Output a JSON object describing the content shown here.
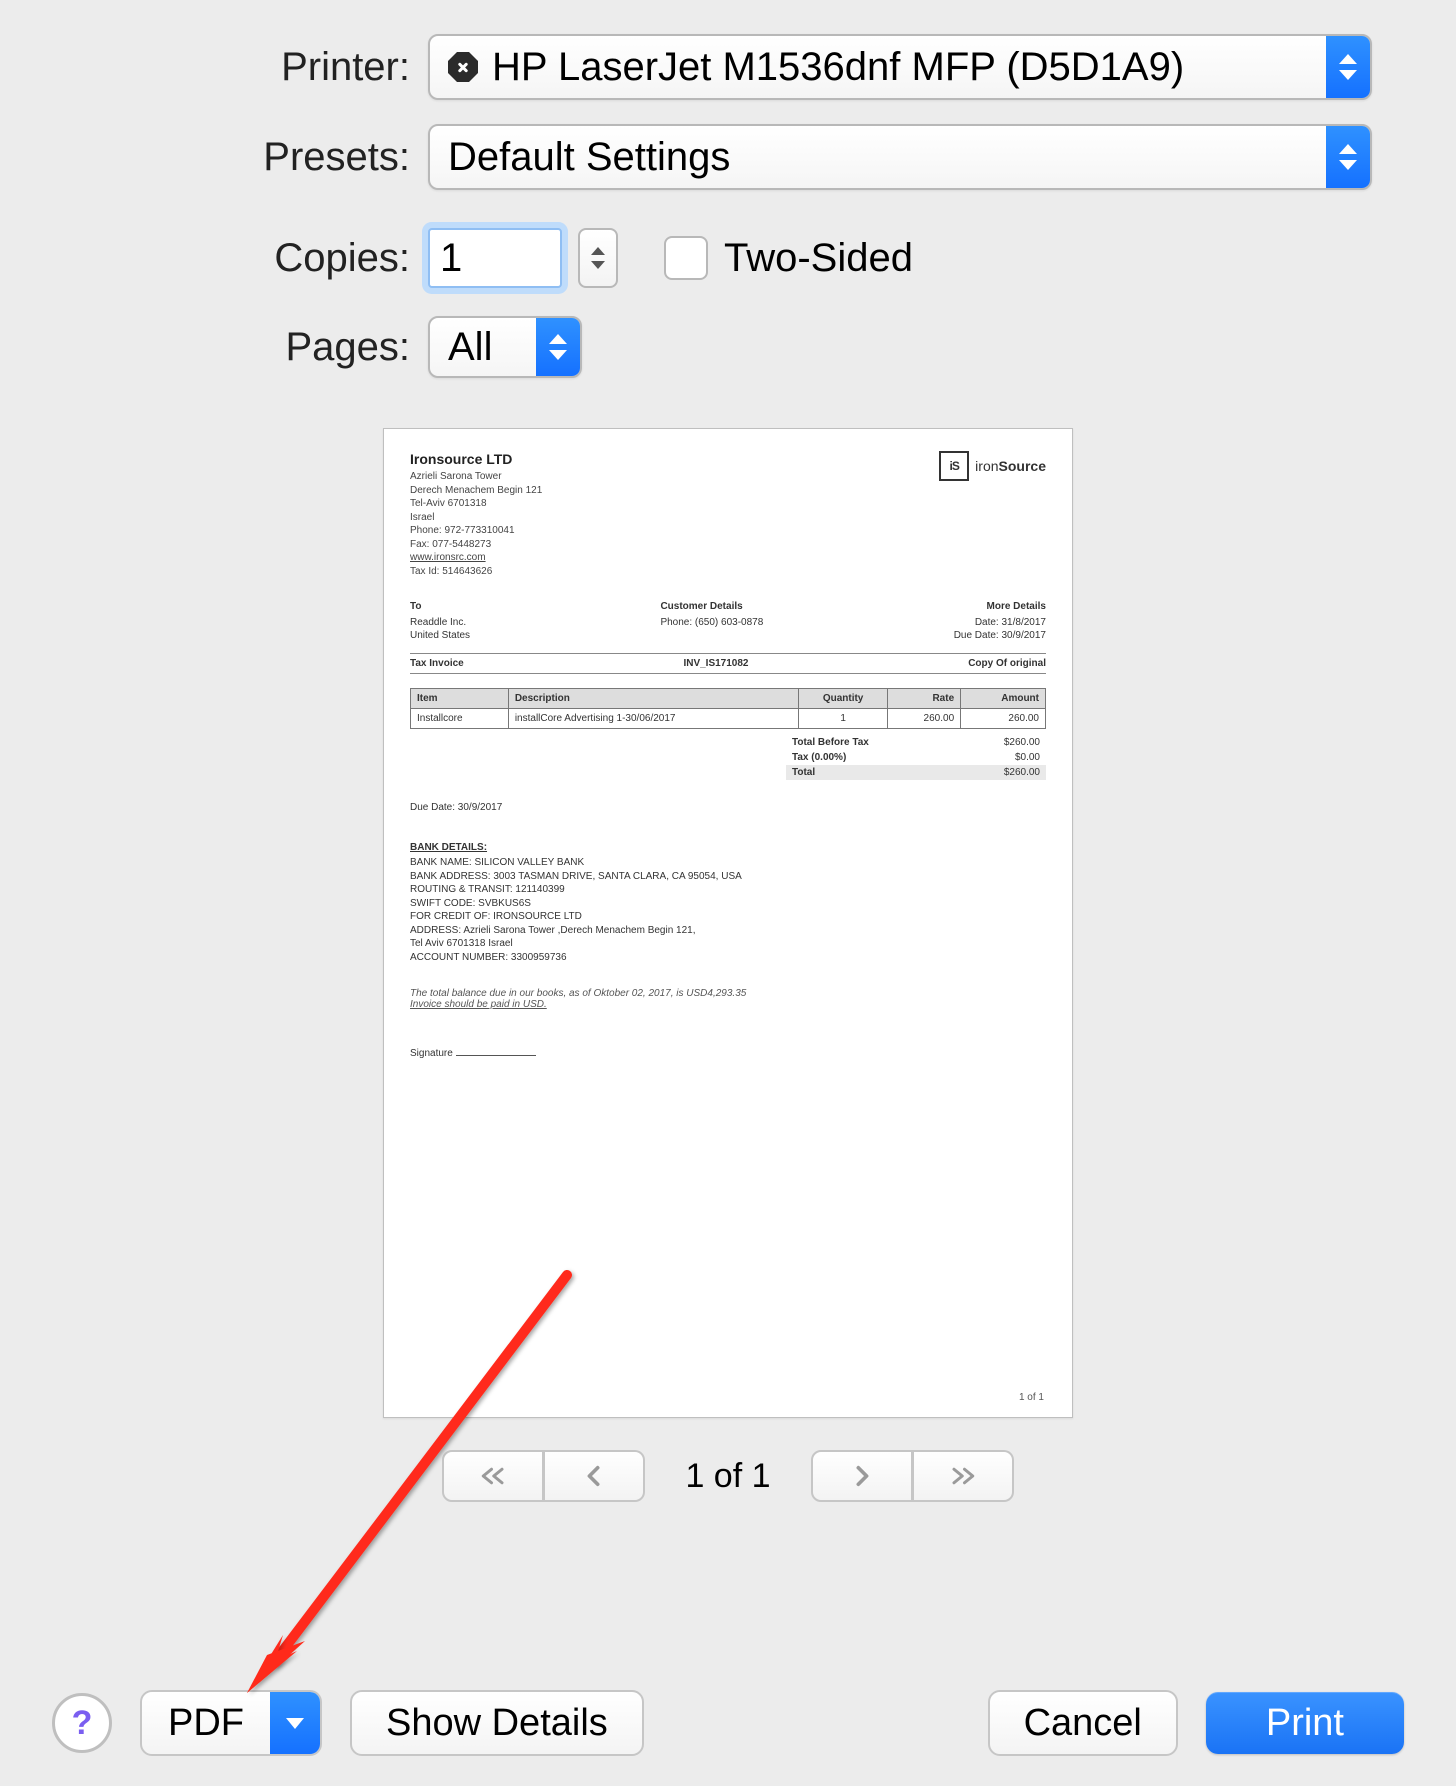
{
  "labels": {
    "printer": "Printer:",
    "presets": "Presets:",
    "copies": "Copies:",
    "pages": "Pages:",
    "two_sided": "Two-Sided"
  },
  "printer": {
    "name": "HP LaserJet M1536dnf MFP (D5D1A9)"
  },
  "presets": {
    "value": "Default Settings"
  },
  "copies": {
    "value": "1"
  },
  "pages": {
    "value": "All"
  },
  "pager": {
    "label": "1 of 1"
  },
  "buttons": {
    "pdf": "PDF",
    "show_details": "Show Details",
    "cancel": "Cancel",
    "print": "Print",
    "help": "?"
  },
  "doc": {
    "company": "Ironsource LTD",
    "addr": {
      "l1": "Azrieli Sarona Tower",
      "l2": "Derech Menachem Begin 121",
      "l3": "Tel-Aviv 6701318",
      "l4": "Israel",
      "l5": "Phone: 972-773310041",
      "l6": "Fax: 077-5448273",
      "link": "www.ironsrc.com",
      "l8": "Tax Id: 514643626"
    },
    "logo": {
      "mark": "iS",
      "t1": "iron",
      "t2": "Source"
    },
    "to": {
      "title": "To",
      "l1": "Readdle Inc.",
      "l2": "United States"
    },
    "cust": {
      "title": "Customer Details",
      "l1": "Phone: (650) 603-0878"
    },
    "more": {
      "title": "More Details",
      "l1": "Date: 31/8/2017",
      "l2": "Due Date: 30/9/2017"
    },
    "row": {
      "a": "Tax Invoice",
      "b": "INV_IS171082",
      "c": "Copy Of original"
    },
    "table": {
      "h": {
        "item": "Item",
        "desc": "Description",
        "qty": "Quantity",
        "rate": "Rate",
        "amount": "Amount"
      },
      "r": {
        "item": "Installcore",
        "desc": "installCore Advertising 1-30/06/2017",
        "qty": "1",
        "rate": "260.00",
        "amount": "260.00"
      }
    },
    "totals": {
      "before_l": "Total Before Tax",
      "before_v": "$260.00",
      "tax_l": "Tax (0.00%)",
      "tax_v": "$0.00",
      "total_l": "Total",
      "total_v": "$260.00"
    },
    "due": "Due Date: 30/9/2017",
    "bank": {
      "h": "BANK DETAILS:",
      "l1": "BANK NAME: SILICON VALLEY BANK",
      "l2": "BANK ADDRESS: 3003 TASMAN DRIVE, SANTA CLARA, CA 95054, USA",
      "l3": "ROUTING & TRANSIT: 121140399",
      "l4": "SWIFT CODE: SVBKUS6S",
      "l5": "FOR CREDIT OF: IRONSOURCE LTD",
      "l6": "ADDRESS: Azrieli Sarona Tower ,Derech Menachem Begin 121,",
      "l7": "Tel Aviv 6701318 Israel",
      "l8": "ACCOUNT NUMBER: 3300959736"
    },
    "note": {
      "l1": "The total balance due in our books, as of Oktober 02, 2017, is USD4,293.35",
      "l2": "Invoice should be paid in USD."
    },
    "sig": "Signature",
    "footer": "1 of 1"
  }
}
